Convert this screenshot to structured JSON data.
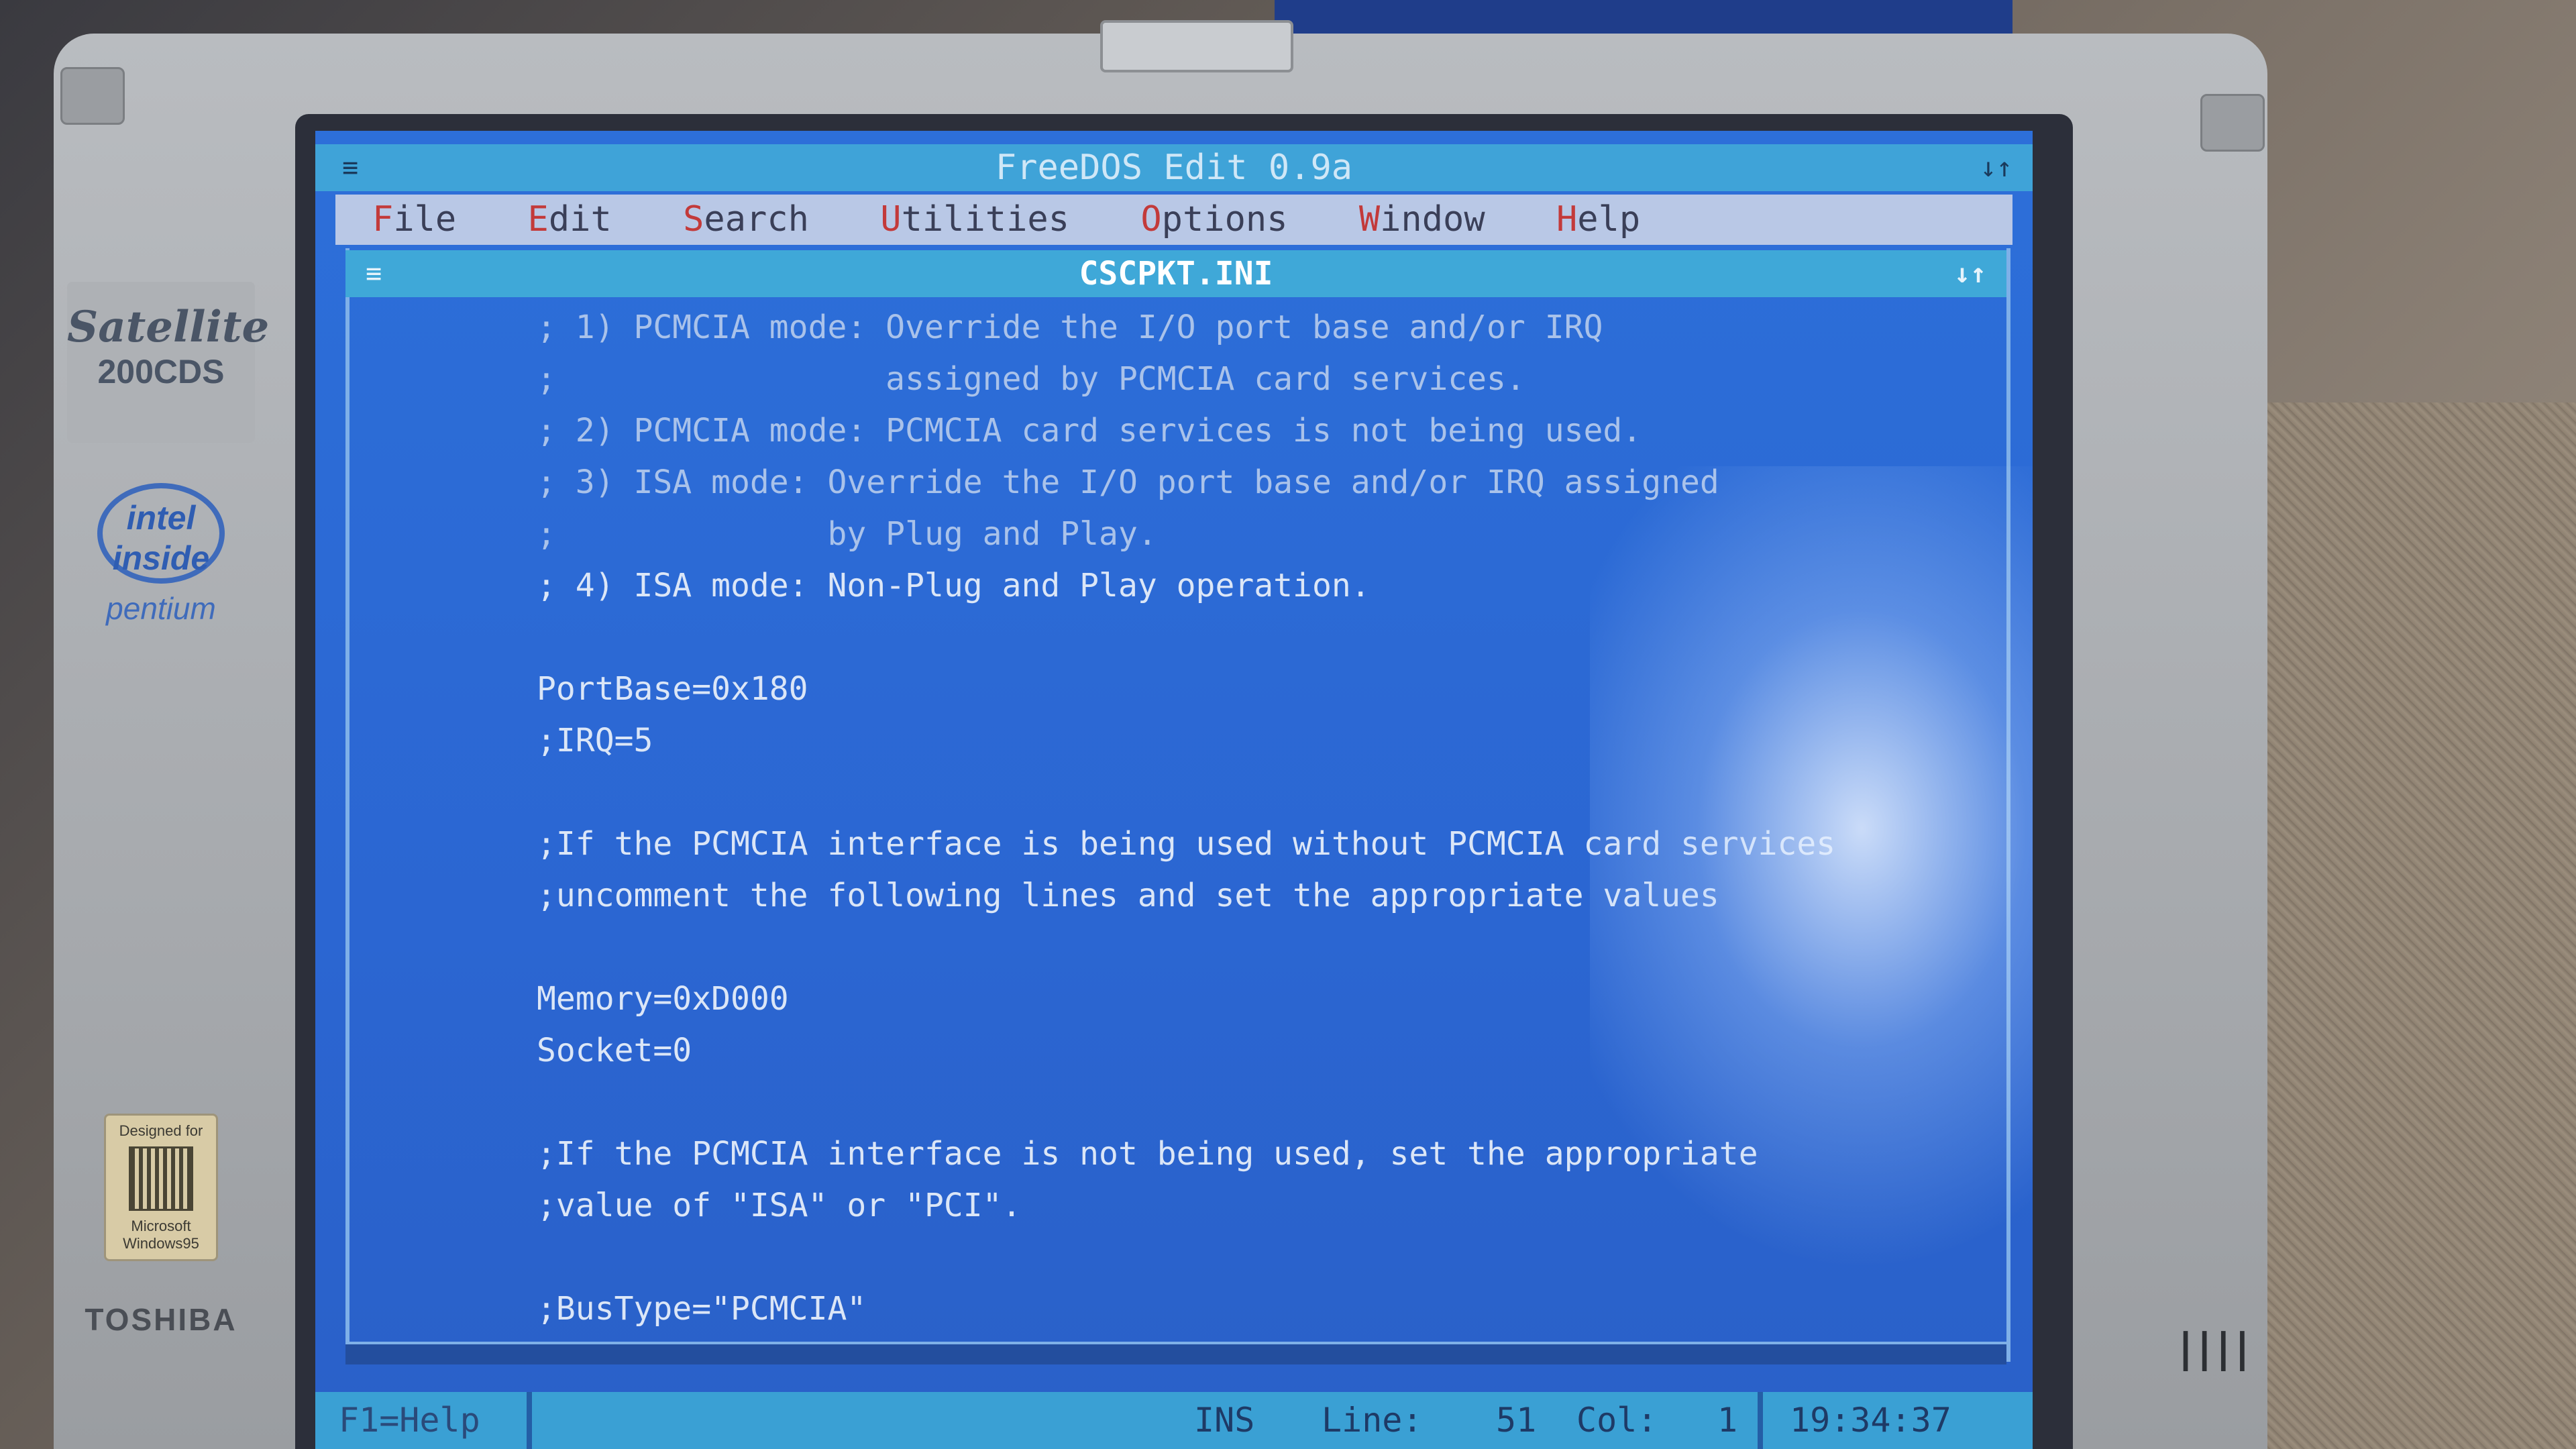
{
  "hardware": {
    "model_line1": "Satellite",
    "model_line2": "200CDS",
    "intel_line": "intel inside",
    "pentium": "pentium",
    "windows_top": "Designed for",
    "windows_brand": "Microsoft",
    "windows_os": "Windows95",
    "maker": "TOSHIBA"
  },
  "app": {
    "title": "FreeDOS Edit 0.9a",
    "sysmenu_glyph": "≡",
    "resize_glyph": "↓↑"
  },
  "menu": {
    "items": [
      {
        "hotkey": "F",
        "rest": "ile"
      },
      {
        "hotkey": "E",
        "rest": "dit"
      },
      {
        "hotkey": "S",
        "rest": "earch"
      },
      {
        "hotkey": "U",
        "rest": "tilities"
      },
      {
        "hotkey": "O",
        "rest": "ptions"
      },
      {
        "hotkey": "W",
        "rest": "indow"
      },
      {
        "hotkey": "H",
        "rest": "elp"
      }
    ]
  },
  "document": {
    "filename": "CSCPKT.INI",
    "lines": [
      "; 1) PCMCIA mode: Override the I/O port base and/or IRQ",
      ";                 assigned by PCMCIA card services.",
      "; 2) PCMCIA mode: PCMCIA card services is not being used.",
      "; 3) ISA mode: Override the I/O port base and/or IRQ assigned",
      ";              by Plug and Play.",
      "; 4) ISA mode: Non-Plug and Play operation.",
      "",
      "PortBase=0x180",
      ";IRQ=5",
      "",
      ";If the PCMCIA interface is being used without PCMCIA card services",
      ";uncomment the following lines and set the appropriate values",
      "",
      "Memory=0xD000",
      "Socket=0",
      "",
      ";If the PCMCIA interface is not being used, set the appropriate",
      ";value of \"ISA\" or \"PCI\".",
      "",
      ";BusType=\"PCMCIA\""
    ]
  },
  "status": {
    "help": "F1=Help",
    "mode": "INS",
    "line_label": "Line:",
    "line_value": "51",
    "col_label": "Col:",
    "col_value": "1",
    "clock": "19:34:37"
  }
}
